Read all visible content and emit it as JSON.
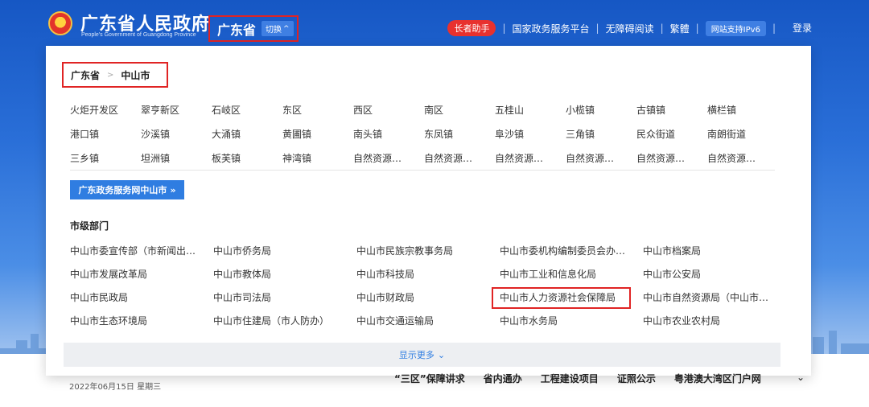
{
  "header": {
    "title": "广东省人民政府",
    "subtitle": "People's Government of Guangdong Province",
    "province": "广东省",
    "switch_label": "切换",
    "links": {
      "elder": "长者助手",
      "national": "国家政务服务平台",
      "accessible": "无障碍阅读",
      "traditional": "繁體",
      "ipv6": "网站支持IPv6",
      "login": "登录"
    }
  },
  "panel": {
    "breadcrumb": {
      "province": "广东省",
      "city": "中山市"
    },
    "districts": [
      [
        "火炬开发区",
        "翠亨新区",
        "石岐区",
        "东区",
        "西区",
        "南区",
        "五桂山",
        "小榄镇",
        "古镇镇",
        "横栏镇"
      ],
      [
        "港口镇",
        "沙溪镇",
        "大涌镇",
        "黄圃镇",
        "南头镇",
        "东凤镇",
        "阜沙镇",
        "三角镇",
        "民众街道",
        "南朗街道"
      ],
      [
        "三乡镇",
        "坦洲镇",
        "板芙镇",
        "神湾镇",
        "自然资源…",
        "自然资源…",
        "自然资源…",
        "自然资源…",
        "自然资源…",
        "自然资源…"
      ]
    ],
    "portal_button": "广东政务服务网中山市",
    "portal_arrow": "»",
    "dept_heading": "市级部门",
    "departments": [
      [
        "中山市委宣传部（市新闻出…",
        "中山市侨务局",
        "中山市民族宗教事务局",
        "中山市委机构编制委员会办…",
        "中山市档案局"
      ],
      [
        "中山市发展改革局",
        "中山市教体局",
        "中山市科技局",
        "中山市工业和信息化局",
        "中山市公安局"
      ],
      [
        "中山市民政局",
        "中山市司法局",
        "中山市财政局",
        "中山市人力资源社会保障局",
        "中山市自然资源局（中山市…"
      ],
      [
        "中山市生态环境局",
        "中山市住建局（市人防办）",
        "中山市交通运输局",
        "中山市水务局",
        "中山市农业农村局"
      ]
    ],
    "more_label": "显示更多"
  },
  "bottom": {
    "date": "2022年06月15日 星期三",
    "nav": [
      "“三区”保障讲求",
      "省内通办",
      "工程建设项目",
      "证照公示",
      "粤港澳大湾区门户网"
    ]
  },
  "colors": {
    "accent": "#2f7de1",
    "highlight_border": "#e02424",
    "header_blue": "#1657c4"
  }
}
